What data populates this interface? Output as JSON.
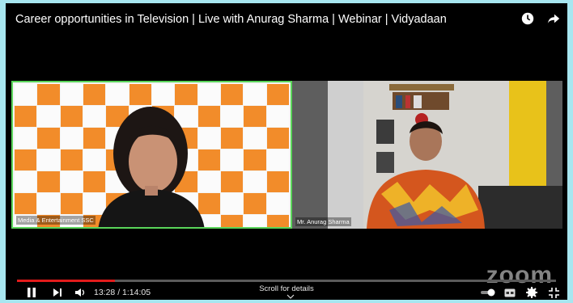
{
  "video": {
    "title": "Career opportunities in Television | Live with Anurag Sharma | Webinar | Vidyadaan"
  },
  "participants": [
    {
      "name": "Media & Entertainment SSC"
    },
    {
      "name": "Mr. Anurag Sharma"
    }
  ],
  "player": {
    "time_display": "13:28 / 1:14:05",
    "progress": 0.182,
    "scroll_hint": "Scroll for details",
    "watermark": "zoom"
  },
  "icons": {
    "watch_later": "clock-icon",
    "share": "share-icon",
    "play": "pause-icon",
    "next": "next-icon",
    "volume": "volume-icon",
    "autoplay": "autoplay-toggle-icon",
    "captions": "captions-icon",
    "settings": "gear-icon",
    "fullscreen": "fullscreen-exit-icon"
  },
  "colors": {
    "active_speaker_border": "#5ad55a",
    "progress": "#e21b1b",
    "backdrop_orange": "#f28c2a"
  }
}
